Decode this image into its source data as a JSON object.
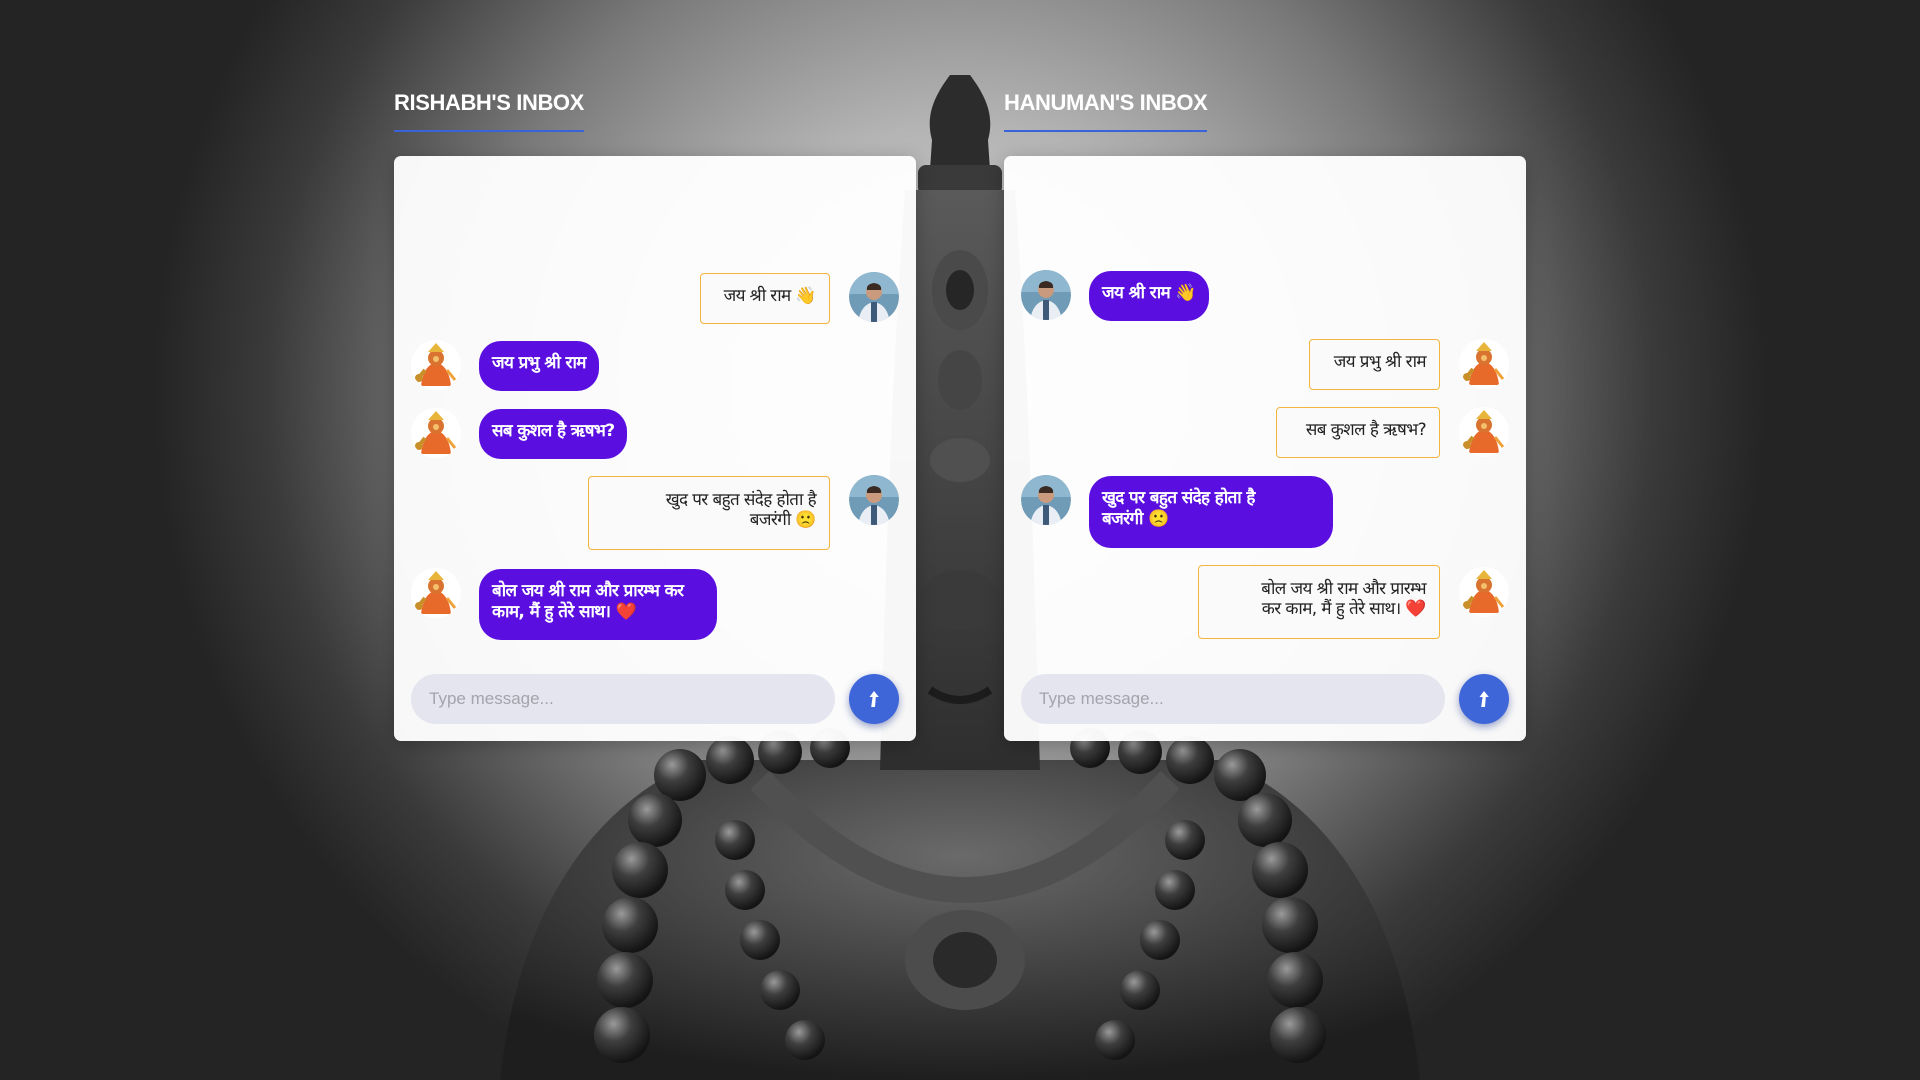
{
  "background": {
    "description_icon": "hanuman-statue-backdrop"
  },
  "colors": {
    "sent_bubble": "#5a0fe0",
    "received_border": "#f3b53c",
    "accent_underline": "#3b63d9",
    "send_button": "#3f66d8"
  },
  "rishabh_inbox": {
    "title": "RISHABH'S INBOX",
    "messages": [
      {
        "text": "जय श्री राम 👋",
        "side": "right",
        "avatar": "rishabh-avatar"
      },
      {
        "text": "जय प्रभु श्री राम",
        "side": "left",
        "avatar": "hanuman-avatar"
      },
      {
        "text": "सब कुशल है ऋषभ?",
        "side": "left",
        "avatar": "hanuman-avatar"
      },
      {
        "line1": "खुद पर बहुत संदेह होता है",
        "line2": "बजरंगी 🙁",
        "side": "right",
        "avatar": "rishabh-avatar"
      },
      {
        "line1": "बोल जय श्री राम और प्रारम्भ कर",
        "line2": "काम, मैं हु तेरे साथ। ❤️",
        "side": "left",
        "avatar": "hanuman-avatar"
      }
    ],
    "input_placeholder": "Type message..."
  },
  "hanuman_inbox": {
    "title": "HANUMAN'S INBOX",
    "messages": [
      {
        "text": "जय श्री राम 👋",
        "side": "left",
        "avatar": "rishabh-avatar"
      },
      {
        "text": "जय प्रभु श्री राम",
        "side": "right",
        "avatar": "hanuman-avatar"
      },
      {
        "text": "सब कुशल है ऋषभ?",
        "side": "right",
        "avatar": "hanuman-avatar"
      },
      {
        "line1": "खुद पर बहुत संदेह होता है",
        "line2": "बजरंगी 🙁",
        "side": "left",
        "avatar": "rishabh-avatar"
      },
      {
        "line1": "बोल जय श्री राम और प्रारम्भ",
        "line2": "कर काम, मैं हु तेरे साथ। ❤️",
        "side": "right",
        "avatar": "hanuman-avatar"
      }
    ],
    "input_placeholder": "Type message..."
  },
  "icons": {
    "send": "arrow-up-icon"
  }
}
